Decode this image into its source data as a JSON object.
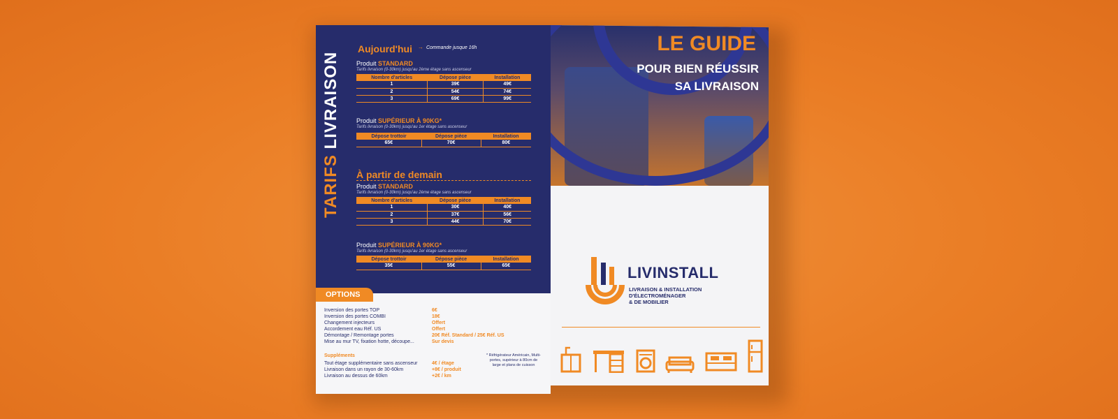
{
  "left_panel": {
    "vertical_title_1": "TARIFS",
    "vertical_title_2": "LIVRAISON",
    "today": {
      "title": "Aujourd'hui",
      "arrow": "→",
      "note": "Commande jusque 16h",
      "standard_prefix": "Produit",
      "standard_label": "STANDARD",
      "standard_sub": "Tarifs livraison (0-30km) jusqu'au 2ème étage sans ascenseur",
      "standard_headers": [
        "Nombre d'articles",
        "Dépose pièce",
        "Installation"
      ],
      "standard_rows": [
        [
          "1",
          "39€",
          "49€"
        ],
        [
          "2",
          "54€",
          "74€"
        ],
        [
          "3",
          "69€",
          "99€"
        ]
      ],
      "heavy_prefix": "Produit",
      "heavy_label": "SUPÉRIEUR À 90KG*",
      "heavy_sub": "Tarifs livraison (0-30km) jusqu'au 1er étage sans ascenseur",
      "heavy_headers": [
        "Dépose trottoir",
        "Dépose pièce",
        "Installation"
      ],
      "heavy_row": [
        "65€",
        "70€",
        "80€"
      ]
    },
    "tomorrow": {
      "title": "À partir de demain",
      "standard_prefix": "Produit",
      "standard_label": "STANDARD",
      "standard_sub": "Tarifs livraison (0-30km) jusqu'au 2ème étage sans ascenseur",
      "standard_headers": [
        "Nombre d'articles",
        "Dépose pièce",
        "Installation"
      ],
      "standard_rows": [
        [
          "1",
          "30€",
          "40€"
        ],
        [
          "2",
          "37€",
          "56€"
        ],
        [
          "3",
          "44€",
          "70€"
        ]
      ],
      "heavy_prefix": "Produit",
      "heavy_label": "SUPÉRIEUR À 90KG*",
      "heavy_sub": "Tarifs livraison (0-30km) jusqu'au 1er étage sans ascenseur",
      "heavy_headers": [
        "Dépose trottoir",
        "Dépose pièce",
        "Installation"
      ],
      "heavy_row": [
        "35€",
        "55€",
        "65€"
      ]
    },
    "options": {
      "title": "OPTIONS",
      "items": [
        {
          "label": "Inversion des portes TOP",
          "price": "6€"
        },
        {
          "label": "Inversion des portes COMBI",
          "price": "18€"
        },
        {
          "label": "Changement injecteurs",
          "price": "Offert"
        },
        {
          "label": "Accordement eau Réf. US",
          "price": "Offert"
        },
        {
          "label": "Démontage / Remontage portes",
          "price": "20€ Réf. Standard / 25€ Réf. US"
        },
        {
          "label": "Mise au mur TV, fixation hotte, découpe...",
          "price": "Sur devis"
        }
      ],
      "supplements_title": "Suppléments",
      "supplements": [
        {
          "label": "Tout étage supplémentaire sans ascenseur",
          "price": "4€ / étage"
        },
        {
          "label": "Livraison dans un rayon de 30-60km",
          "price": "+8€ / produit"
        },
        {
          "label": "Livraison au dessus de 60km",
          "price": "+2€ / km"
        }
      ],
      "footnote": "* Réfrigérateur Américain, Multi-portes, supérieur à 80cm de large et plans de cuisson"
    }
  },
  "right_panel": {
    "headline": "LE GUIDE",
    "subheadline_1": "POUR BIEN RÉUSSIR",
    "subheadline_2": "SA LIVRAISON",
    "brand": "LIVINSTALL",
    "tagline_1": "LIVRAISON & INSTALLATION",
    "tagline_2": "D'ÉLECTROMÉNAGER",
    "tagline_3": "& DE MOBILIER",
    "icons": [
      "sink-cabinet-icon",
      "desk-icon",
      "washing-machine-icon",
      "sofa-icon",
      "bed-icon",
      "fridge-icon"
    ]
  },
  "colors": {
    "navy": "#262c6b",
    "orange": "#f08a24",
    "background": "#ea7d25"
  }
}
